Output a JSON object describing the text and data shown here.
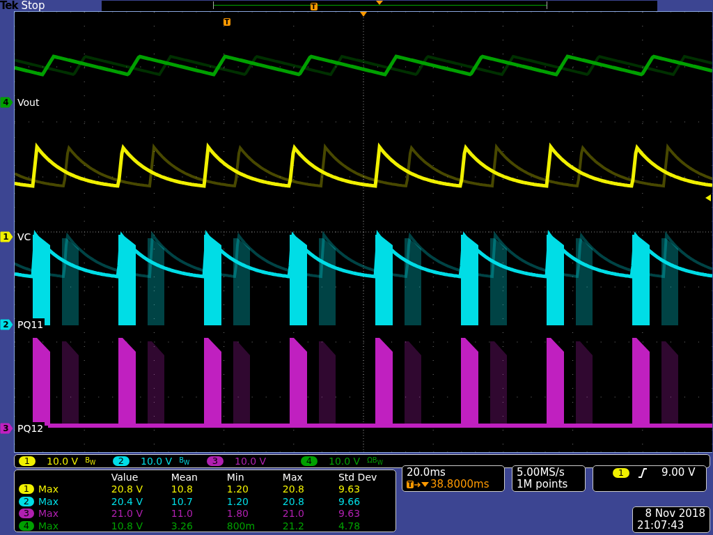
{
  "header": {
    "brand": "Tek",
    "status": "Stop",
    "trigger_marker": "T"
  },
  "graticule": {
    "trigger_marker": "T"
  },
  "channels": [
    {
      "number": "4",
      "label": "Vout",
      "color": "#00a000"
    },
    {
      "number": "1",
      "label": "VC",
      "color": "#f0f000"
    },
    {
      "number": "2",
      "label": "PQ11",
      "color": "#00dde6"
    },
    {
      "number": "3",
      "label": "PQ12",
      "color": "#c020c0"
    }
  ],
  "readouts": [
    {
      "number": "1",
      "scale": "10.0 V",
      "bw_mark": "B$_{W}$",
      "color": "#f0f000"
    },
    {
      "number": "2",
      "scale": "10.0 V",
      "bw_mark": "B$_{W}$",
      "color": "#00dde6"
    },
    {
      "number": "3",
      "scale": "10.0 V",
      "color": "#b020b0"
    },
    {
      "number": "4",
      "scale": "10.0 V",
      "bw_mark": "ΩB$_{W}$",
      "color": "#00a000"
    }
  ],
  "measurements": {
    "columns": [
      "Value",
      "Mean",
      "Min",
      "Max",
      "Std Dev"
    ],
    "rows": [
      {
        "channel": "1",
        "type": "Max",
        "color": "#f0f000",
        "values": [
          "20.8 V",
          "10.8",
          "1.20",
          "20.8",
          "9.63"
        ]
      },
      {
        "channel": "2",
        "type": "Max",
        "color": "#00dde6",
        "values": [
          "20.4 V",
          "10.7",
          "1.20",
          "20.8",
          "9.66"
        ]
      },
      {
        "channel": "3",
        "type": "Max",
        "color": "#b020b0",
        "values": [
          "21.0 V",
          "11.0",
          "1.80",
          "21.0",
          "9.63"
        ]
      },
      {
        "channel": "4",
        "type": "Max",
        "color": "#00a000",
        "values": [
          "10.8 V",
          "3.26",
          "800m",
          "21.2",
          "4.78"
        ]
      }
    ]
  },
  "timebase": {
    "scale": "20.0ms",
    "trigger_marker": "T",
    "delay": "38.8000ms"
  },
  "acquisition": {
    "sample_rate": "5.00MS/s",
    "record_length": "1M points"
  },
  "trigger": {
    "source": "1",
    "rising_edge": true,
    "level": "9.00 V",
    "color": "#f0f000"
  },
  "datetime": {
    "date": "8 Nov 2018",
    "time": "21:07:43"
  }
}
